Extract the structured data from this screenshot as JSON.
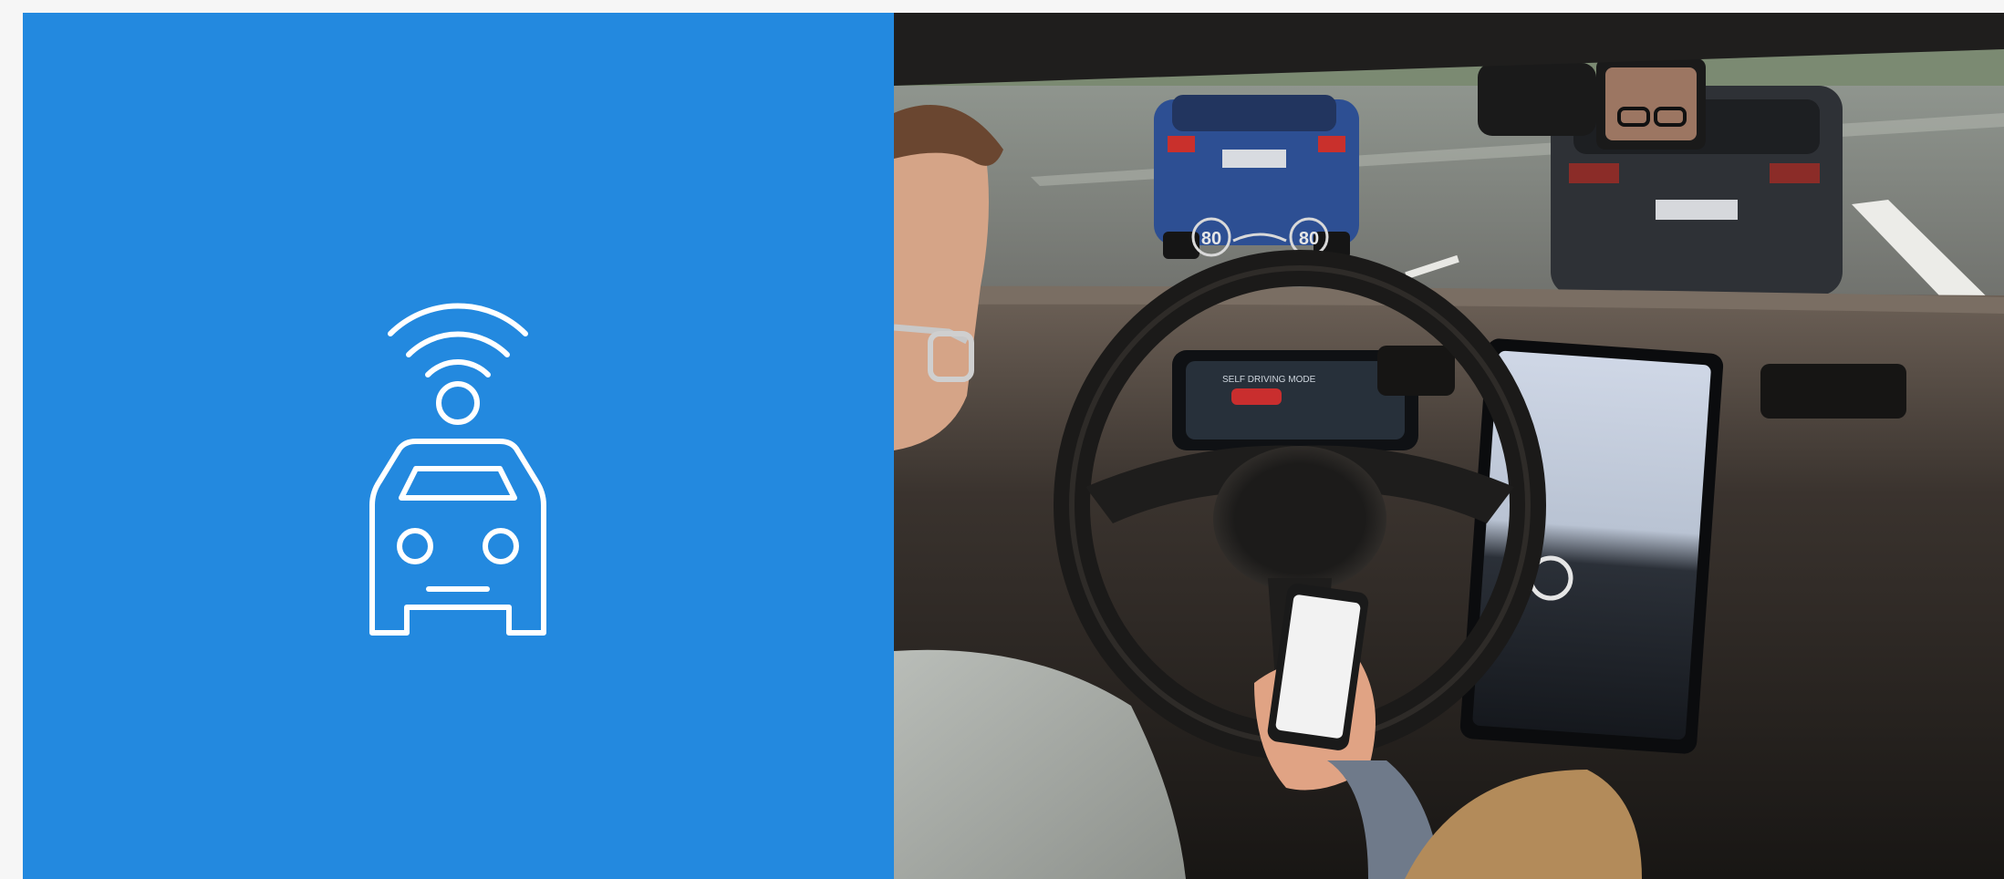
{
  "left_panel": {
    "background_color": "#2389df",
    "icon": "connected-car-icon",
    "icon_color": "#ffffff"
  },
  "right_panel": {
    "image": "self-driving-car-interior-photo",
    "hud_speed_left": "80",
    "hud_speed_right": "80",
    "instrument_cluster_text": "SELF DRIVING MODE"
  }
}
